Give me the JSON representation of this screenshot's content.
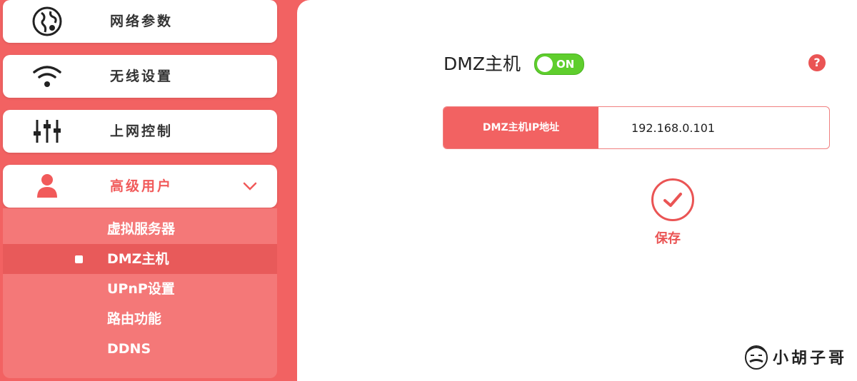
{
  "sidebar": {
    "items": [
      {
        "label": "网络参数",
        "icon": "globe-icon"
      },
      {
        "label": "无线设置",
        "icon": "wifi-icon"
      },
      {
        "label": "上网控制",
        "icon": "sliders-icon"
      },
      {
        "label": "高级用户",
        "icon": "user-icon",
        "expanded": true
      }
    ],
    "submenu": [
      {
        "label": "虚拟服务器"
      },
      {
        "label": "DMZ主机",
        "selected": true
      },
      {
        "label": "UPnP设置"
      },
      {
        "label": "路由功能"
      },
      {
        "label": "DDNS"
      }
    ]
  },
  "main": {
    "title": "DMZ主机",
    "toggle": {
      "state": "ON",
      "on": true
    },
    "help_icon": "question-icon",
    "ip_field": {
      "label": "DMZ主机IP地址",
      "value": "192.168.0.101"
    },
    "save": {
      "label": "保存",
      "icon": "check-icon"
    }
  },
  "watermark": {
    "text": "小胡子哥"
  },
  "colors": {
    "accent": "#f26262",
    "submenu_bg": "#f47878",
    "toggle_on": "#5fce2d"
  }
}
